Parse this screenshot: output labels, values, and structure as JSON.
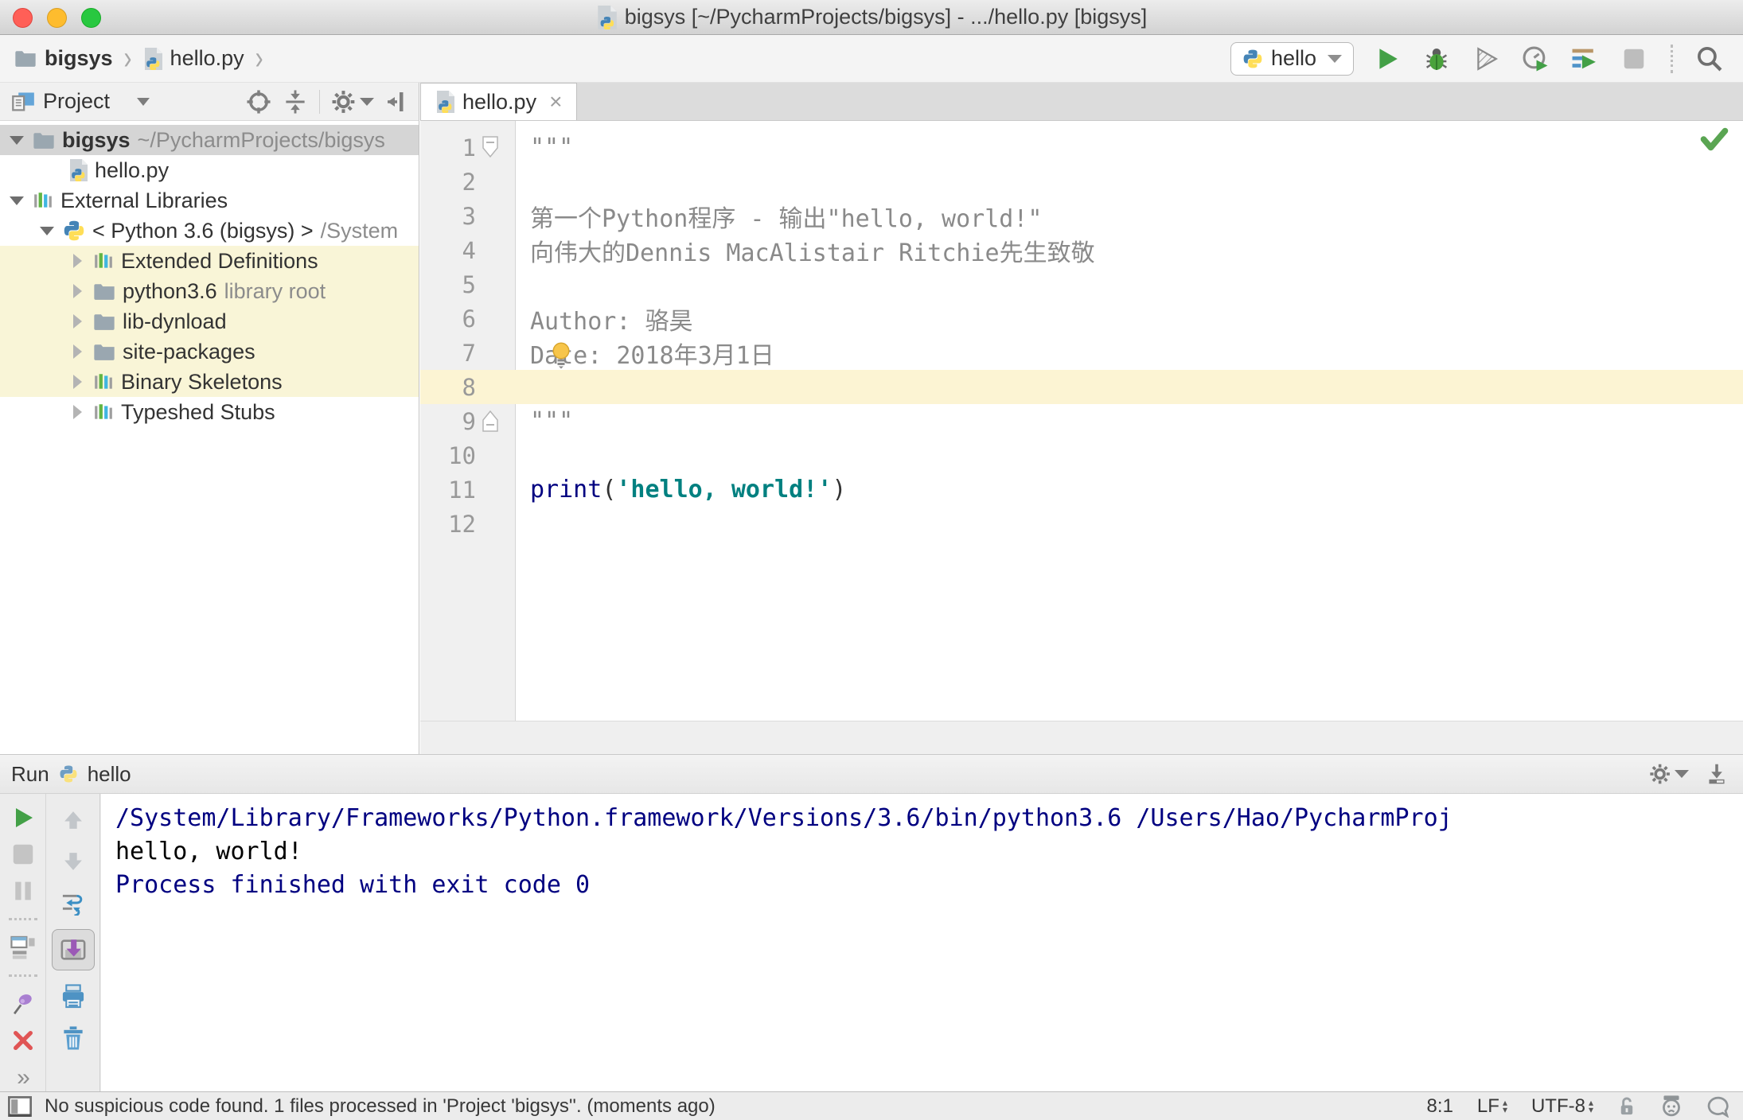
{
  "window": {
    "title": "bigsys [~/PycharmProjects/bigsys] - .../hello.py [bigsys]"
  },
  "navbar": {
    "breadcrumb_project": "bigsys",
    "breadcrumb_file": "hello.py",
    "run_config": "hello"
  },
  "project_panel": {
    "header": "Project",
    "tree": [
      {
        "name": "bigsys",
        "suffix": "~/PycharmProjects/bigsys"
      },
      {
        "name": "hello.py",
        "suffix": ""
      },
      {
        "name": "External Libraries",
        "suffix": ""
      },
      {
        "name": "< Python 3.6 (bigsys) >",
        "suffix": "/System"
      },
      {
        "name": "Extended Definitions",
        "suffix": ""
      },
      {
        "name": "python3.6",
        "suffix": "library root"
      },
      {
        "name": "lib-dynload",
        "suffix": ""
      },
      {
        "name": "site-packages",
        "suffix": ""
      },
      {
        "name": "Binary Skeletons",
        "suffix": ""
      },
      {
        "name": "Typeshed Stubs",
        "suffix": ""
      }
    ]
  },
  "editor": {
    "tab": "hello.py",
    "lines": [
      {
        "n": "1",
        "text": "\"\"\""
      },
      {
        "n": "2",
        "text": ""
      },
      {
        "n": "3",
        "text": "第一个Python程序 - 输出\"hello, world!\""
      },
      {
        "n": "4",
        "text": "向伟大的Dennis MacAlistair Ritchie先生致敬"
      },
      {
        "n": "5",
        "text": ""
      },
      {
        "n": "6",
        "text": "Author: 骆昊"
      },
      {
        "n": "7",
        "text": "Date: 2018年3月1日"
      },
      {
        "n": "8",
        "text": ""
      },
      {
        "n": "9",
        "text": "\"\"\""
      },
      {
        "n": "10",
        "text": ""
      },
      {
        "n": "11",
        "text": ""
      },
      {
        "n": "12",
        "text": ""
      }
    ],
    "code_line": {
      "keyword": "print",
      "paren_open": "(",
      "string": "'hello, world!'",
      "paren_close": ")"
    }
  },
  "run_panel": {
    "label": "Run",
    "config": "hello",
    "console": {
      "line1": "/System/Library/Frameworks/Python.framework/Versions/3.6/bin/python3.6 /Users/Hao/PycharmProj",
      "line2": "hello, world!",
      "line3": "",
      "line4": "Process finished with exit code 0"
    }
  },
  "status_bar": {
    "message": "No suspicious code found. 1 files processed in 'Project 'bigsys''. (moments ago)",
    "caret": "8:1",
    "line_separator": "LF",
    "encoding": "UTF-8"
  },
  "colors": {
    "accent_green": "#43a047",
    "keyword": "#000080",
    "string": "#008080",
    "comment": "#8a8a8a",
    "console_system": "#000080",
    "selection_gray": "#d5d5d5",
    "tree_highlight": "#f9f5d7"
  }
}
